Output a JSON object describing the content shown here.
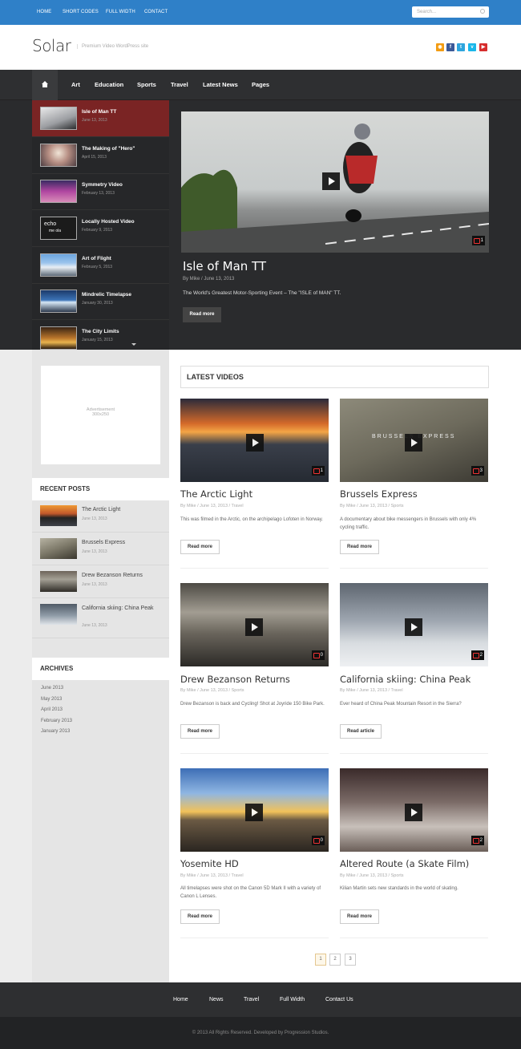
{
  "topnav": {
    "items": [
      {
        "label": "HOME"
      },
      {
        "label": "SHORT CODES"
      },
      {
        "label": "FULL WIDTH"
      },
      {
        "label": "CONTACT"
      }
    ],
    "search_placeholder": "Search..."
  },
  "header": {
    "logo": "Solar",
    "tagline": "Premium Video WordPress site",
    "social": [
      "rss-icon",
      "facebook-icon",
      "twitter-icon",
      "vimeo-icon",
      "youtube-icon"
    ]
  },
  "mainnav": {
    "items": [
      {
        "label": "Art"
      },
      {
        "label": "Education"
      },
      {
        "label": "Sports"
      },
      {
        "label": "Travel"
      },
      {
        "label": "Latest News"
      },
      {
        "label": "Pages"
      }
    ]
  },
  "slider": {
    "items": [
      {
        "title": "Isle of Man TT",
        "date": "June 13, 2013"
      },
      {
        "title": "The Making of \"Hero\"",
        "date": "April 15, 2013"
      },
      {
        "title": "Symmetry Video",
        "date": "February 13, 2013"
      },
      {
        "title": "Locally Hosted Video",
        "date": "February 9, 2013"
      },
      {
        "title": "Art of Flight",
        "date": "February 5, 2013"
      },
      {
        "title": "Mindrelic Timelapse",
        "date": "January 30, 2013"
      },
      {
        "title": "The City Limits",
        "date": "January 15, 2013"
      }
    ],
    "thumb_text": "echo",
    "thumb_subtext": "me ola"
  },
  "featured": {
    "title": "Isle of Man TT",
    "meta": "By Mike / June 13, 2013",
    "desc": "The World's Greatest Motor-Sporting Event – The \"ISLE of MAN\" TT.",
    "read_more": "Read more",
    "comments": "1"
  },
  "sidebar": {
    "ad": "Advertisement\n300x250",
    "recent_heading": "RECENT POSTS",
    "recent": [
      {
        "title": "The Arctic Light",
        "date": "June 13, 2013"
      },
      {
        "title": "Brussels Express",
        "date": "June 13, 2013"
      },
      {
        "title": "Drew Bezanson Returns",
        "date": "June 13, 2013"
      },
      {
        "title": "California skiing: China Peak",
        "date": "June 13, 2013"
      }
    ],
    "archives_heading": "ARCHIVES",
    "archives": [
      "June 2013",
      "May 2013",
      "April 2013",
      "February 2013",
      "January 2013"
    ]
  },
  "latest": {
    "heading": "LATEST VIDEOS",
    "videos": [
      {
        "title": "The Arctic Light",
        "meta": "By Mike / June 13, 2013 / Travel",
        "desc": "This was filmed in the Arctic, on the archipelago Lofoten in Norway.",
        "button": "Read more",
        "comments": "1"
      },
      {
        "title": "Brussels Express",
        "meta": "By Mike / June 13, 2013 / Sports",
        "desc": "A documentary about bike messengers in Brussels with only 4% cycling traffic.",
        "button": "Read more",
        "comments": "3",
        "overlay": "BRUSSELS EXPRESS"
      },
      {
        "title": "Drew Bezanson Returns",
        "meta": "By Mike / June 13, 2013 / Sports",
        "desc": "Drew Bezanson is back and Cycling! Shot at Joyride 150 Bike Park.",
        "button": "Read more",
        "comments": "0"
      },
      {
        "title": "California skiing: China Peak",
        "meta": "By Mike / June 13, 2013 / Travel",
        "desc": "Ever heard of China Peak Mountain Resort in the Sierra?",
        "button": "Read article",
        "comments": "2"
      },
      {
        "title": "Yosemite HD",
        "meta": "By Mike / June 13, 2013 / Travel",
        "desc": "All timelapses were shot on the Canon 5D Mark II with a variety of Canon L Lenses.",
        "button": "Read more",
        "comments": "0"
      },
      {
        "title": "Altered Route (a Skate Film)",
        "meta": "By Mike / June 13, 2013 / Sports",
        "desc": "Kilian Martin sets new standards in the world of skating.",
        "button": "Read more",
        "comments": "2"
      }
    ]
  },
  "pagination": [
    "1",
    "2",
    "3"
  ],
  "footer": {
    "nav": [
      {
        "label": "Home"
      },
      {
        "label": "News"
      },
      {
        "label": "Travel"
      },
      {
        "label": "Full Width"
      },
      {
        "label": "Contact Us"
      }
    ],
    "copyright": "© 2013 All Rights Reserved. Developed by Progression Studios."
  }
}
